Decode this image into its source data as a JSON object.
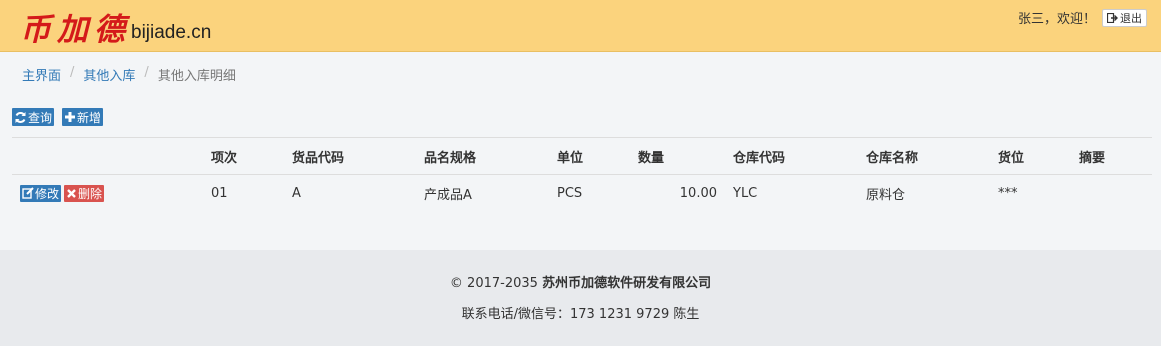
{
  "header": {
    "logo_cn": "币加德",
    "logo_en": "bijiade.cn",
    "welcome": "张三，欢迎！",
    "logout_label": "退出",
    "bg_color": "#fbd37d",
    "logo_color": "#d41a1a"
  },
  "breadcrumb": {
    "items": [
      "主界面",
      "其他入库"
    ],
    "current": "其他入库明细",
    "separator": "/"
  },
  "toolbar": {
    "query_label": "查询",
    "add_label": "新增",
    "button_color": "#337ab7"
  },
  "table": {
    "columns": [
      "项次",
      "货品代码",
      "品名规格",
      "单位",
      "数量",
      "仓库代码",
      "仓库名称",
      "货位",
      "摘要"
    ],
    "edit_label": "修改",
    "delete_label": "删除",
    "rows": [
      {
        "seq": "01",
        "code": "A",
        "name": "产成品A",
        "unit": "PCS",
        "qty": "10.00",
        "wh_code": "YLC",
        "wh_name": "原料仓",
        "location": "***",
        "remark": ""
      }
    ]
  },
  "footer": {
    "copyright_prefix": "© 2017-2035",
    "company": "苏州币加德软件研发有限公司",
    "contact": "联系电话/微信号：173 1231 9729 陈生"
  }
}
